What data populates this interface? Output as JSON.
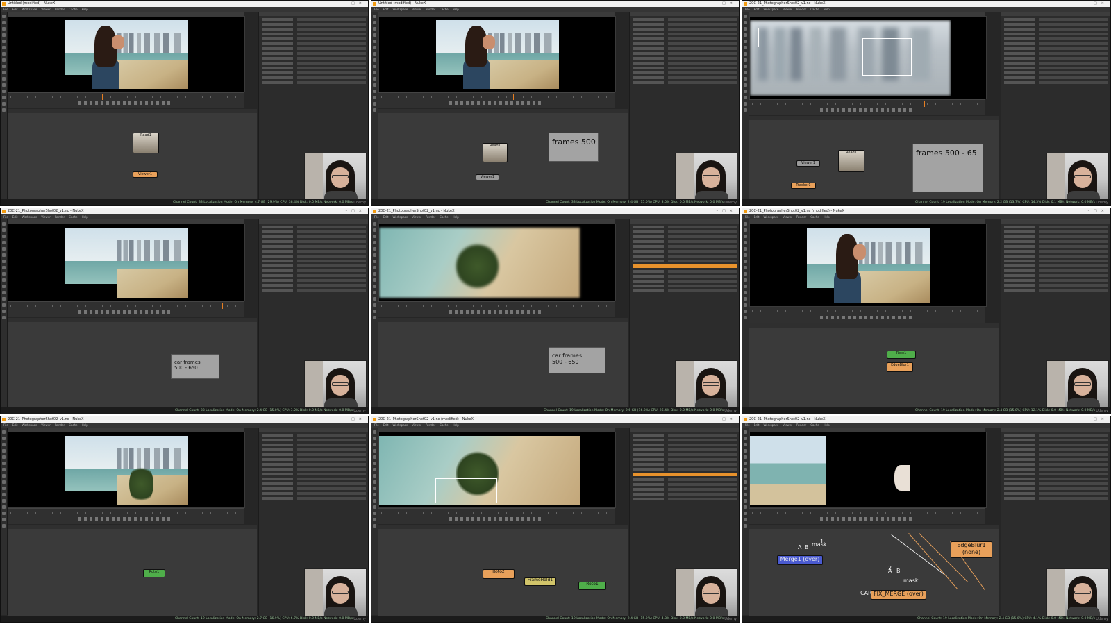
{
  "panels": [
    {
      "title": "Untitled (modified) - NukeX",
      "backdrop_text": "",
      "nodes": [
        {
          "label": "Read1",
          "color": "n-thumb"
        },
        {
          "label": "Viewer1",
          "color": "n-orange"
        }
      ]
    },
    {
      "title": "Untitled (modified) - NukeX",
      "backdrop_text": "frames 500",
      "nodes": [
        {
          "label": "Read1",
          "color": "n-thumb"
        },
        {
          "label": "Viewer1",
          "color": "n-grey"
        }
      ]
    },
    {
      "title": "20C-21_PhotographerShot02_v1.nc - NukeX",
      "backdrop_text": "frames 500 - 65",
      "nodes": [
        {
          "label": "Read1",
          "color": "n-thumb"
        },
        {
          "label": "Viewer1",
          "color": "n-grey"
        },
        {
          "label": "Tracker1",
          "color": "n-orange"
        }
      ]
    },
    {
      "title": "20C-21_PhotographerShot02_v1.nc - NukeX",
      "backdrop_text": "car frames\n500 - 650",
      "nodes": []
    },
    {
      "title": "20C-21_PhotographerShot02_v1.nc - NukeX",
      "backdrop_text": "car frames\n500 - 650",
      "nodes": []
    },
    {
      "title": "20C-21_PhotographerShot02_v1.nc (modified) - NukeX",
      "backdrop_text": "",
      "nodes": [
        {
          "label": "Roto1",
          "color": "n-green"
        },
        {
          "label": "EdgeBlur1",
          "color": "n-orange"
        }
      ]
    },
    {
      "title": "20C-21_PhotographerShot02_v1.nc - NukeX",
      "backdrop_text": "",
      "nodes": [
        {
          "label": "Roto1",
          "color": "n-green"
        }
      ]
    },
    {
      "title": "20C-21_PhotographerShot02_v1.nc (modified) - NukeX",
      "backdrop_text": "",
      "nodes": [
        {
          "label": "Roto2",
          "color": "n-orange"
        },
        {
          "label": "FrameHold1",
          "color": "n-yellow"
        },
        {
          "label": "Roto1",
          "color": "n-green"
        }
      ]
    },
    {
      "title": "20C-21_PhotographerShot02_v1.nc - NukeX",
      "backdrop_text": "",
      "nodes": [
        {
          "label": "EdgeBlur1\n(none)",
          "color": "n-orange"
        },
        {
          "label": "Merge1 (over)",
          "color": "n-blue"
        },
        {
          "label": "FIX_MERGE (over)",
          "color": "n-orange"
        }
      ],
      "graph_labels": [
        "A",
        "B",
        "mask",
        "A",
        "B",
        "mask",
        "2",
        "1",
        "CAR"
      ]
    }
  ],
  "menus": [
    "File",
    "Edit",
    "Workspace",
    "Viewer",
    "Render",
    "Cache",
    "Help"
  ],
  "status": [
    "Channel Count: 33 Localization Mode: On Memory: 4.7 GB (29.9%) CPU: 38.4% Disk: 0.0 MB/s Network: 0.0 MB/s",
    "Channel Count: 33 Localization Mode: On Memory: 2.4 GB (15.0%) CPU: 3.0% Disk: 0.0 MB/s Network: 0.0 MB/s",
    "Channel Count: 19 Localization Mode: On Memory: 2.2 GB (13.7%) CPU: 14.3% Disk: 0.1 MB/s Network: 0.0 MB/s",
    "Channel Count: 33 Localization Mode: On Memory: 2.4 GB (15.0%) CPU: 3.2% Disk: 0.0 MB/s Network: 0.0 MB/s",
    "Channel Count: 19 Localization Mode: On Memory: 2.6 GB (16.2%) CPU: 26.4% Disk: 0.0 MB/s Network: 0.0 MB/s",
    "Channel Count: 19 Localization Mode: On Memory: 2.4 GB (15.0%) CPU: 12.1% Disk: 0.0 MB/s Network: 0.0 MB/s",
    "Channel Count: 19 Localization Mode: On Memory: 2.7 GB (16.9%) CPU: 6.7% Disk: 0.0 MB/s Network: 0.0 MB/s",
    "Channel Count: 19 Localization Mode: On Memory: 2.4 GB (15.0%) CPU: 4.8% Disk: 0.0 MB/s Network: 0.0 MB/s",
    "Channel Count: 19 Localization Mode: On Memory: 2.4 GB (15.0%) CPU: 4.1% Disk: 0.0 MB/s Network: 0.0 MB/s"
  ],
  "watermark": "Udemy",
  "colors": {
    "accent": "#e8922c",
    "status_text": "#9bc59b",
    "panel_bg": "#262626"
  }
}
